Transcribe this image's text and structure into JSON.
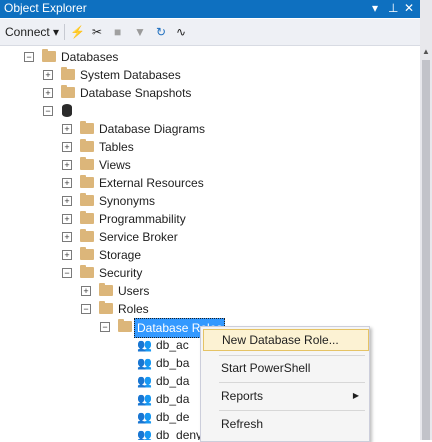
{
  "window": {
    "title": "Object Explorer",
    "pin_icon": "pin-icon",
    "close_glyph": "✕"
  },
  "toolbar": {
    "connect_label": "Connect",
    "dropdown_glyph": "▾"
  },
  "tree": {
    "databases": "Databases",
    "system_databases": "System Databases",
    "database_snapshots": "Database Snapshots",
    "db_children": [
      "Database Diagrams",
      "Tables",
      "Views",
      "External Resources",
      "Synonyms",
      "Programmability",
      "Service Broker",
      "Storage",
      "Security"
    ],
    "users": "Users",
    "roles": "Roles",
    "database_roles": "Database Roles",
    "role_items": [
      "db_ac",
      "db_ba",
      "db_da",
      "db_da",
      "db_de",
      "db_denydatawriter"
    ]
  },
  "context_menu": {
    "items": [
      "New Database Role...",
      "Start PowerShell",
      "Reports",
      "Refresh"
    ],
    "highlighted": "New Database Role..."
  },
  "colors": {
    "titlebar": "#0e70c0",
    "selection": "#3399ff",
    "folder": "#dcb67a",
    "menu_highlight": "#fcf2d3"
  }
}
